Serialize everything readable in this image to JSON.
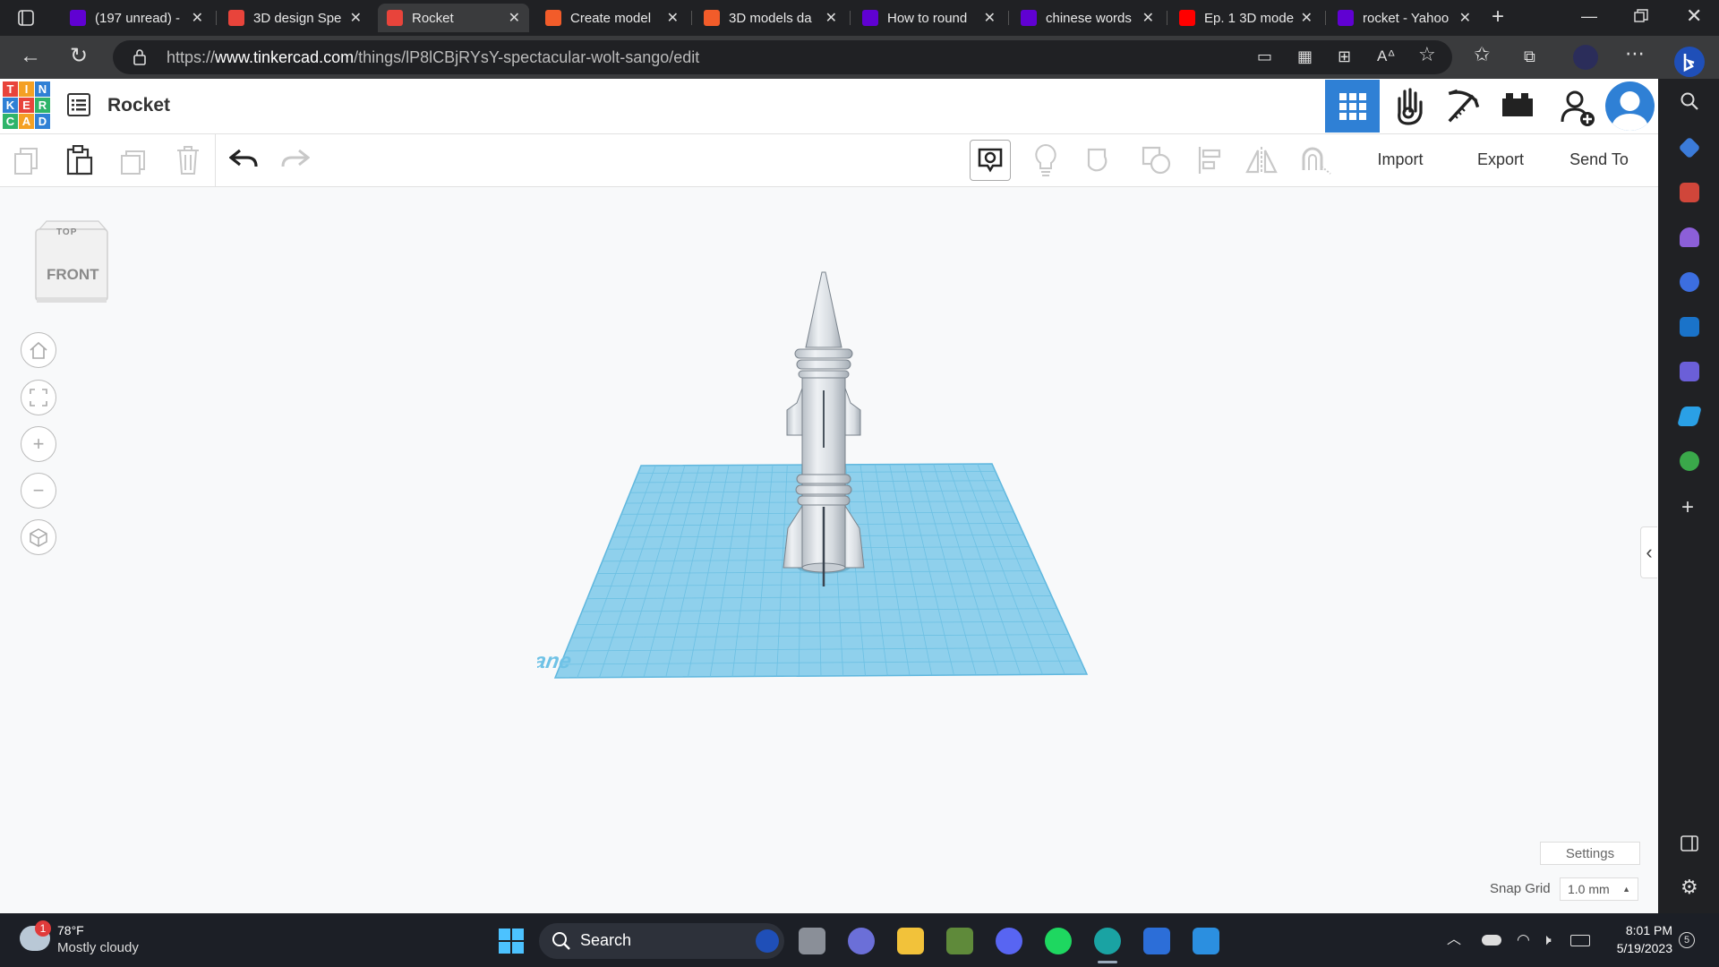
{
  "browser": {
    "tabs": [
      {
        "title": "(197 unread) -",
        "favicon": "yahoo-mail-icon",
        "color": "#6001d2"
      },
      {
        "title": "3D design Spe",
        "favicon": "tinkercad-icon",
        "color": "#e8443b"
      },
      {
        "title": "Rocket",
        "favicon": "tinkercad-icon",
        "color": "#e8443b"
      },
      {
        "title": "Create model",
        "favicon": "sketchfab-icon",
        "color": "#f25c2a"
      },
      {
        "title": "3D models da",
        "favicon": "sketchfab-icon",
        "color": "#f25c2a"
      },
      {
        "title": "How to round",
        "favicon": "yahoo-icon",
        "color": "#6001d2"
      },
      {
        "title": "chinese words",
        "favicon": "yahoo-icon",
        "color": "#6001d2"
      },
      {
        "title": "Ep. 1 3D mode",
        "favicon": "youtube-icon",
        "color": "#ff0000"
      },
      {
        "title": "rocket - Yahoo",
        "favicon": "yahoo-icon",
        "color": "#6001d2"
      }
    ],
    "url_prefix": "https://",
    "url_host": "www.tinkercad.com",
    "url_path": "/things/lP8lCBjRYsY-spectacular-wolt-sango/edit"
  },
  "app": {
    "logo": [
      "T",
      "I",
      "N",
      "K",
      "E",
      "R",
      "C",
      "A",
      "D"
    ],
    "design_title": "Rocket",
    "import_label": "Import",
    "export_label": "Export",
    "sendto_label": "Send To",
    "viewcube_front": "FRONT",
    "viewcube_top": "TOP",
    "workplane_label": "Workplane",
    "settings_label": "Settings",
    "snap_grid_label": "Snap Grid",
    "snap_grid_value": "1.0 mm"
  },
  "taskbar": {
    "weather_temp": "78°F",
    "weather_desc": "Mostly cloudy",
    "weather_badge": "1",
    "search_label": "Search",
    "time": "8:01 PM",
    "date": "5/19/2023",
    "notification_count": "5"
  },
  "colors": {
    "workplane": "#8fd0ec",
    "grid_line": "#5fb7de",
    "accent": "#2f80d5"
  }
}
